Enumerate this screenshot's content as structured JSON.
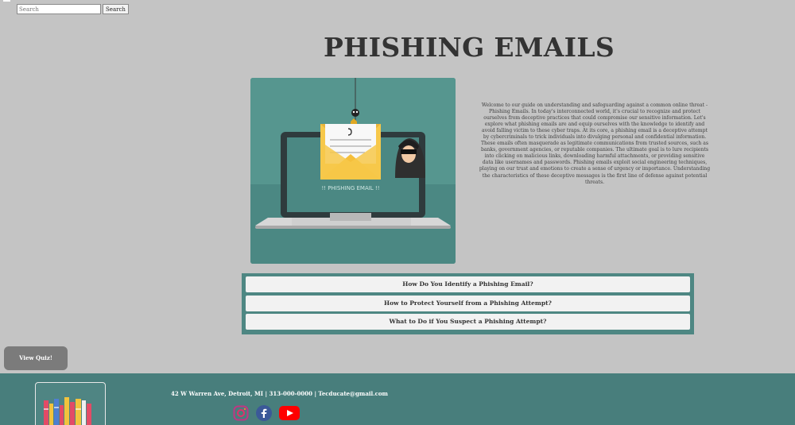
{
  "search": {
    "placeholder": "Search",
    "button_label": "Search"
  },
  "page": {
    "title": "PHISHING EMAILS",
    "intro": "Welcome to our guide on understanding and safeguarding against a common online threat - Phishing Emails. In today's interconnected world, it's crucial to recognize and protect ourselves from deceptive practices that could compromise our sensitive information. Let's explore what phishing emails are and equip ourselves with the knowledge to identify and avoid falling victim to these cyber traps. At its core, a phishing email is a deceptive attempt by cybercriminals to trick individuals into divulging personal and confidential information. These emails often masquerade as legitimate communications from trusted sources, such as banks, government agencies, or reputable companies. The ultimate goal is to lure recipients into clicking on malicious links, downloading harmful attachments, or providing sensitive data like usernames and passwords. Phishing emails exploit social engineering techniques, playing on our trust and emotions to create a sense of urgency or importance. Understanding the characteristics of these deceptive messages is the first line of defense against potential threats."
  },
  "hero": {
    "screen_text": "!! PHISHING EMAIL !!"
  },
  "accordion": [
    {
      "label": "How Do You Identify a Phishing Email?"
    },
    {
      "label": "How to Protect Yourself from a Phishing Attempt?"
    },
    {
      "label": "What to Do if You Suspect a Phishing Attempt?"
    }
  ],
  "quiz": {
    "label": "View Quiz!"
  },
  "footer": {
    "contact": "42 W Warren Ave, Detroit, MI | 313-000-0000 | Tecducate@gmail.com",
    "socials": [
      "instagram-icon",
      "facebook-icon",
      "youtube-icon"
    ]
  },
  "colors": {
    "background": "#c4c4c4",
    "teal": "#56968f",
    "footer": "#487e7c",
    "accordion_frame": "#4e8783"
  }
}
